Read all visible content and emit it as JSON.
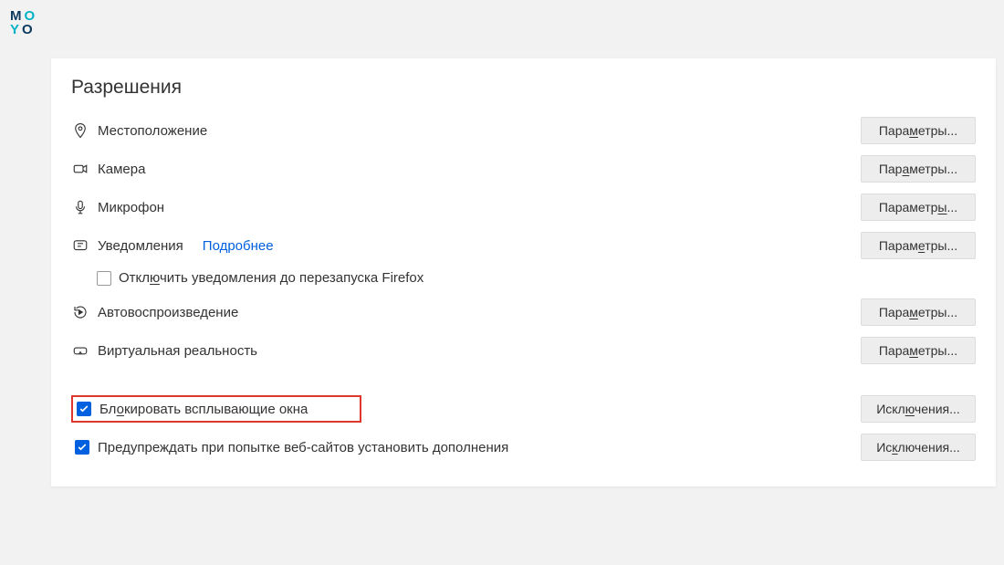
{
  "logo": {
    "m": "M",
    "o1": "O",
    "y": "Y",
    "o2": "O"
  },
  "section": {
    "title": "Разрешения"
  },
  "permissions": {
    "location": {
      "label": "Местоположение",
      "button_pre": "Пара",
      "button_u": "м",
      "button_post": "етры..."
    },
    "camera": {
      "label": "Камера",
      "button_pre": "Пар",
      "button_u": "а",
      "button_post": "метры..."
    },
    "microphone": {
      "label": "Микрофон",
      "button_pre": "Параметр",
      "button_u": "ы",
      "button_post": "..."
    },
    "notifications": {
      "label": "Уведомления",
      "link": "Подробнее",
      "button_pre": "Парам",
      "button_u": "е",
      "button_post": "тры..."
    },
    "notifications_sub": {
      "label": "Отключить уведомления до перезапуска Firefox",
      "u_pre": "Откл",
      "u_u": "ю",
      "u_post": "чить уведомления до перезапуска Firefox"
    },
    "autoplay": {
      "label": "Автовоспроизведение",
      "button_pre": "Пара",
      "button_u": "м",
      "button_post": "етры..."
    },
    "vr": {
      "label": "Виртуальная реальность",
      "button_pre": "Пара",
      "button_u": "м",
      "button_post": "етры..."
    }
  },
  "checkboxes": {
    "block_popups": {
      "label_pre": "Бл",
      "label_u": "о",
      "label_post": "кировать всплывающие окна",
      "button_pre": "Искл",
      "button_u": "ю",
      "button_post": "чения..."
    },
    "warn_addons": {
      "label": "Предупреждать при попытке веб-сайтов установить дополнения",
      "button_pre": "Ис",
      "button_u": "к",
      "button_post": "лючения..."
    }
  }
}
